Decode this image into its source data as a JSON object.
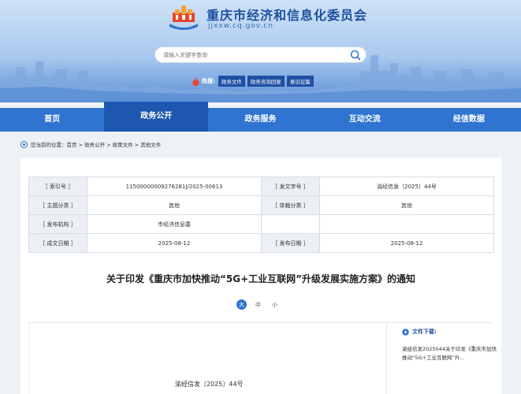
{
  "site": {
    "title": "重庆市经济和信息化委员会",
    "domain": "jjxxw.cq.gov.cn"
  },
  "search": {
    "placeholder": "请输入关键字查询"
  },
  "hot": {
    "label": "热搜:",
    "tags": [
      "政务文件",
      "政务咨询回复",
      "意见征集"
    ]
  },
  "nav": {
    "items": [
      {
        "label": "首页",
        "active": false
      },
      {
        "label": "政务公开",
        "active": true
      },
      {
        "label": "政务服务",
        "active": false
      },
      {
        "label": "互动交流",
        "active": false
      },
      {
        "label": "经信数据",
        "active": false
      }
    ]
  },
  "breadcrumb": "您当前的位置：首页 > 政务公开 > 政策文件 > 其他文件",
  "meta": {
    "rows": [
      [
        "［ 索引号 ］",
        "11500000009276281J/2025-00613",
        "［ 发文字号 ］",
        "渝经信发〔2025〕44号"
      ],
      [
        "［ 主题分类 ］",
        "其他",
        "［ 体裁分类 ］",
        "其他"
      ],
      [
        "［ 发布机构 ］",
        "市经济信息委",
        "",
        ""
      ],
      [
        "［ 成文日期 ］",
        "2025-08-12",
        "［ 发布日期 ］",
        "2025-08-12"
      ]
    ]
  },
  "document": {
    "title": "关于印发《重庆市加快推动“5G+工业互联网”升级发展实施方案》的通知",
    "font_sizes": [
      "大",
      "中",
      "小"
    ],
    "doc_number": "渝经信发〔2025〕44号"
  },
  "download": {
    "heading": "文件下载:",
    "link": "渝经信发2025044关于印发《重庆市加快推动“5G+工业互联网”升..."
  },
  "colors": {
    "primary": "#2f74d0",
    "active_nav": "#1e57b0",
    "title_blue": "#1d4f9e"
  }
}
